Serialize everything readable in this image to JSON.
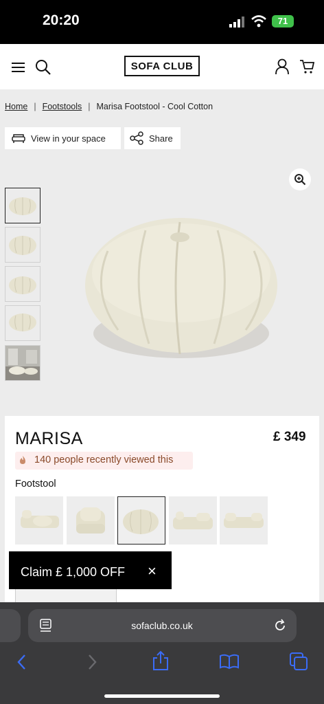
{
  "status_bar": {
    "time": "20:20",
    "battery": "71"
  },
  "header": {
    "logo": "SOFA CLUB"
  },
  "breadcrumb": {
    "items": [
      "Home",
      "Footstools"
    ],
    "current": "Marisa Footstool - Cool Cotton",
    "separator": "|"
  },
  "actions": {
    "view_in_space": "View in your space",
    "share": "Share"
  },
  "product": {
    "name": "MARISA",
    "price": "£ 349",
    "recently_viewed": "140 people recently viewed this",
    "variant_label": "Footstool"
  },
  "promo": {
    "claim": "Claim £ 1,000 OFF",
    "close": "×"
  },
  "browser": {
    "url": "sofaclub.co.uk"
  },
  "colors": {
    "fabric": "#e9e6d6",
    "badge_bg": "#fdeeee",
    "badge_text": "#8a4a2a",
    "safari_blue": "#3b6cf6"
  }
}
